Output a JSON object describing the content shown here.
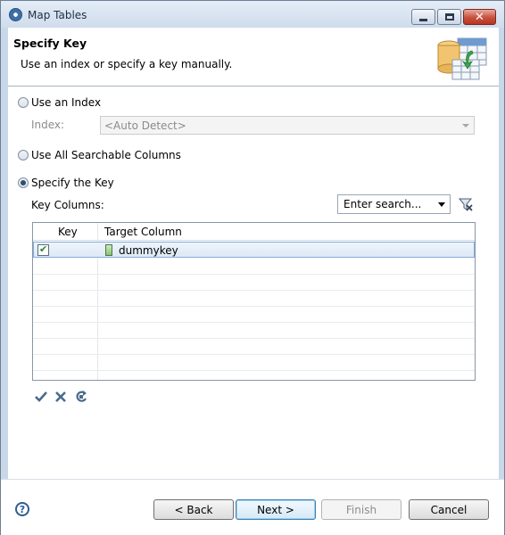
{
  "window": {
    "title": "Map Tables",
    "close_glyph": "✕"
  },
  "header": {
    "title": "Specify Key",
    "description": "Use an index or specify a key manually."
  },
  "options": {
    "use_index": {
      "label": "Use an Index",
      "checked": false
    },
    "index_label": "Index:",
    "index_combo_value": "<Auto Detect>",
    "use_all_searchable": {
      "label": "Use All Searchable Columns",
      "checked": false
    },
    "specify_key": {
      "label": "Specify the Key",
      "checked": true
    }
  },
  "key_columns": {
    "label": "Key Columns:",
    "search_value": "Enter search...",
    "table": {
      "headers": [
        "Key",
        "Target Column"
      ],
      "rows": [
        {
          "key_checked": true,
          "target_column": "dummykey",
          "selected": true
        }
      ],
      "empty_rows": 8
    }
  },
  "table_toolbar": {
    "select_all_icon": "check-icon",
    "deselect_all_icon": "x-icon",
    "refresh_icon": "refresh-icon"
  },
  "footer": {
    "help_glyph": "?",
    "back_label": "< Back",
    "next_label": "Next >",
    "finish_label": "Finish",
    "cancel_label": "Cancel"
  },
  "colors": {
    "selection": "#dde9f6",
    "selection_border": "#84acdd",
    "default_button_border": "#3c7fb1"
  }
}
